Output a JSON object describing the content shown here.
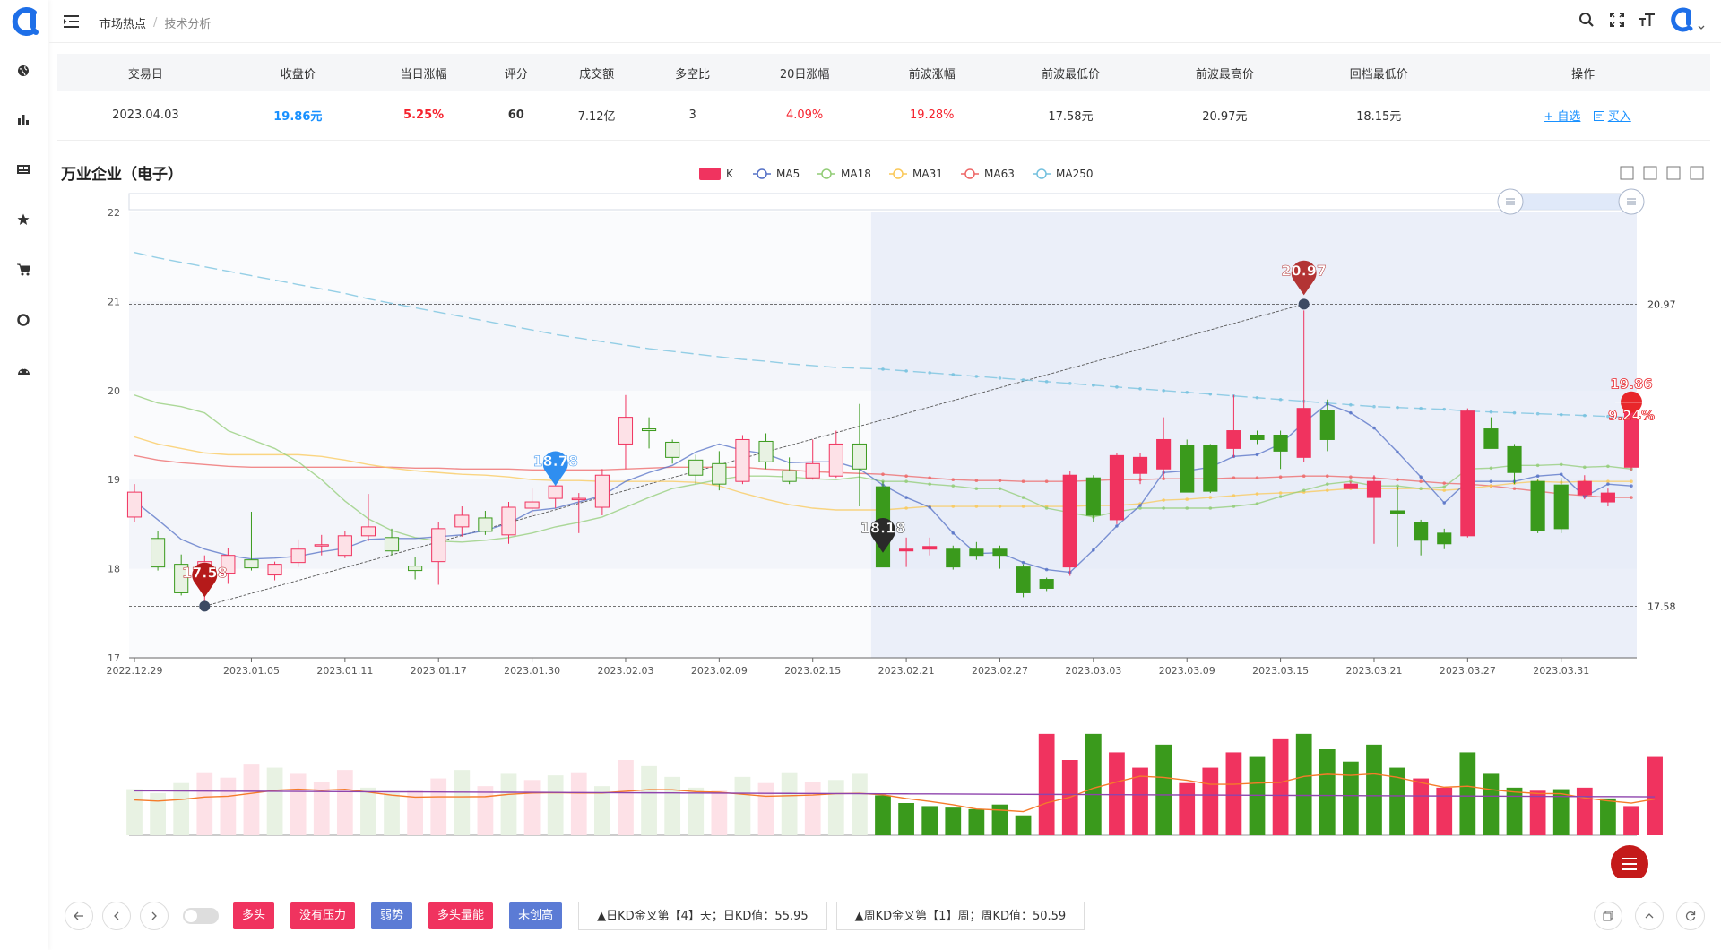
{
  "breadcrumb": {
    "first": "市场热点",
    "sep": "/",
    "second": "技术分析"
  },
  "sidebar_icons": [
    "globe-icon",
    "bar-chart-icon",
    "news-icon",
    "star-icon",
    "cart-icon",
    "life-ring-icon",
    "dashboard-icon"
  ],
  "table": {
    "headers": [
      "交易日",
      "收盘价",
      "当日涨幅",
      "评分",
      "成交额",
      "多空比",
      "20日涨幅",
      "前波涨幅",
      "前波最低价",
      "前波最高价",
      "回档最低价",
      "操作"
    ],
    "row": [
      "2023.04.03",
      "19.86元",
      "5.25%",
      "60",
      "7.12亿",
      "3",
      "4.09%",
      "19.28%",
      "17.58元",
      "20.97元",
      "18.15元"
    ],
    "op_add": "+ 自选",
    "op_buy": "买入"
  },
  "chart": {
    "title": "万业企业（电子）"
  },
  "chart_data": {
    "type": "candlestick",
    "legend": [
      "K",
      "MA5",
      "MA18",
      "MA31",
      "MA63",
      "MA250"
    ],
    "legend_colors": [
      "#f0335f",
      "#5470c6",
      "#91cc75",
      "#fac858",
      "#ee6666",
      "#73c0de"
    ],
    "ylim": [
      17,
      22
    ],
    "yticks": [
      "17",
      "18",
      "19",
      "20",
      "21",
      "22"
    ],
    "xticks": [
      "2022.12.29",
      "2023.01.05",
      "2023.01.11",
      "2023.01.17",
      "2023.01.30",
      "2023.02.03",
      "2023.02.09",
      "2023.02.15",
      "2023.02.21",
      "2023.02.27",
      "2023.03.03",
      "2023.03.09",
      "2023.03.15",
      "2023.03.21",
      "2023.03.27",
      "2023.03.31"
    ],
    "candles": [
      [
        18.58,
        18.86,
        18.95,
        18.52
      ],
      [
        18.34,
        18.02,
        18.42,
        17.98
      ],
      [
        18.05,
        17.73,
        18.16,
        17.7
      ],
      [
        17.9,
        18.08,
        18.15,
        17.58
      ],
      [
        17.95,
        18.15,
        18.23,
        17.83
      ],
      [
        18.1,
        18.01,
        18.64,
        17.98
      ],
      [
        17.93,
        18.05,
        18.08,
        17.87
      ],
      [
        18.07,
        18.22,
        18.33,
        18.02
      ],
      [
        18.27,
        18.27,
        18.38,
        18.15
      ],
      [
        18.15,
        18.37,
        18.42,
        18.12
      ],
      [
        18.37,
        18.47,
        18.84,
        18.31
      ],
      [
        18.35,
        18.2,
        18.45,
        18.15
      ],
      [
        18.03,
        17.98,
        18.13,
        17.88
      ],
      [
        18.08,
        18.45,
        18.52,
        17.82
      ],
      [
        18.47,
        18.6,
        18.7,
        18.36
      ],
      [
        18.57,
        18.42,
        18.65,
        18.38
      ],
      [
        18.38,
        18.69,
        18.75,
        18.28
      ],
      [
        18.68,
        18.75,
        18.9,
        18.59
      ],
      [
        18.79,
        18.93,
        19.15,
        18.68
      ],
      [
        18.79,
        18.79,
        18.85,
        18.4
      ],
      [
        18.69,
        19.05,
        19.12,
        18.6
      ],
      [
        19.4,
        19.7,
        19.95,
        19.12
      ],
      [
        19.57,
        19.55,
        19.7,
        19.35
      ],
      [
        19.42,
        19.25,
        19.45,
        19.18
      ],
      [
        19.22,
        19.05,
        19.28,
        18.95
      ],
      [
        19.18,
        18.95,
        19.32,
        18.88
      ],
      [
        18.98,
        19.45,
        19.5,
        18.95
      ],
      [
        19.43,
        19.2,
        19.52,
        19.12
      ],
      [
        19.1,
        18.98,
        19.25,
        18.95
      ],
      [
        19.02,
        19.18,
        19.45,
        19.0
      ],
      [
        19.04,
        19.4,
        19.55,
        19.02
      ],
      [
        19.4,
        19.12,
        19.85,
        18.7
      ],
      [
        18.92,
        18.02,
        18.98,
        18.02
      ],
      [
        18.2,
        18.22,
        18.35,
        18.02
      ],
      [
        18.22,
        18.25,
        18.35,
        18.15
      ],
      [
        18.22,
        18.02,
        18.26,
        17.99
      ],
      [
        18.22,
        18.15,
        18.3,
        18.1
      ],
      [
        18.22,
        18.15,
        18.26,
        18.0
      ],
      [
        18.02,
        17.73,
        18.05,
        17.68
      ],
      [
        17.88,
        17.78,
        17.9,
        17.75
      ],
      [
        18.02,
        19.05,
        19.1,
        17.92
      ],
      [
        19.02,
        18.6,
        19.05,
        18.52
      ],
      [
        18.55,
        19.27,
        19.3,
        18.5
      ],
      [
        19.07,
        19.25,
        19.3,
        18.95
      ],
      [
        19.12,
        19.45,
        19.7,
        19.02
      ],
      [
        19.38,
        18.86,
        19.45,
        18.86
      ],
      [
        19.38,
        18.87,
        19.4,
        18.85
      ],
      [
        19.35,
        19.55,
        19.95,
        19.25
      ],
      [
        19.5,
        19.45,
        19.55,
        19.4
      ],
      [
        19.5,
        19.32,
        19.55,
        19.12
      ],
      [
        19.25,
        19.8,
        20.9,
        19.2
      ],
      [
        19.78,
        19.45,
        19.9,
        19.32
      ],
      [
        18.9,
        18.95,
        18.98,
        18.9
      ],
      [
        18.8,
        18.98,
        19.05,
        18.28
      ],
      [
        18.65,
        18.62,
        18.92,
        18.25
      ],
      [
        18.52,
        18.32,
        18.55,
        18.15
      ],
      [
        18.4,
        18.28,
        18.45,
        18.22
      ],
      [
        18.37,
        19.77,
        19.8,
        18.35
      ],
      [
        19.57,
        19.35,
        19.7,
        19.35
      ],
      [
        19.37,
        19.08,
        19.4,
        18.95
      ],
      [
        18.98,
        18.43,
        19.0,
        18.4
      ],
      [
        18.94,
        18.45,
        19.02,
        18.4
      ],
      [
        18.83,
        18.98,
        19.05,
        18.78
      ],
      [
        18.75,
        18.85,
        18.9,
        18.7
      ],
      [
        19.14,
        19.86,
        19.95,
        19.1
      ]
    ],
    "ma5": [
      18.76,
      18.55,
      18.33,
      18.22,
      18.15,
      18.11,
      18.12,
      18.14,
      18.19,
      18.23,
      18.33,
      18.34,
      18.34,
      18.36,
      18.38,
      18.43,
      18.51,
      18.65,
      18.68,
      18.75,
      18.82,
      18.98,
      19.08,
      19.16,
      19.31,
      19.4,
      19.33,
      19.29,
      19.19,
      19.2,
      19.2,
      19.12,
      18.94,
      18.8,
      18.69,
      18.4,
      18.17,
      18.18,
      18.07,
      17.99,
      17.96,
      18.21,
      18.48,
      18.71,
      19.08,
      19.1,
      19.14,
      19.26,
      19.28,
      19.4,
      19.64,
      19.85,
      19.75,
      19.58,
      19.31,
      19.03,
      18.74,
      18.98,
      18.98,
      18.98,
      19.04,
      19.06,
      18.81,
      18.95,
      18.93
    ],
    "ma18": [
      19.95,
      19.86,
      19.82,
      19.75,
      19.55,
      19.45,
      19.35,
      19.2,
      19.0,
      18.76,
      18.56,
      18.43,
      18.35,
      18.31,
      18.3,
      18.32,
      18.35,
      18.4,
      18.47,
      18.52,
      18.58,
      18.69,
      18.8,
      18.9,
      18.95,
      19.0,
      19.04,
      19.04,
      19.03,
      19.01,
      19.0,
      19.03,
      18.98,
      18.98,
      18.95,
      18.93,
      18.9,
      18.9,
      18.8,
      18.68,
      18.63,
      18.58,
      18.64,
      18.68,
      18.68,
      18.68,
      18.68,
      18.7,
      18.73,
      18.81,
      18.88,
      18.95,
      18.98,
      18.93,
      18.93,
      18.9,
      18.92,
      19.12,
      19.13,
      19.16,
      19.16,
      19.17,
      19.14,
      19.15,
      19.12
    ],
    "ma31": [
      19.48,
      19.4,
      19.35,
      19.3,
      19.28,
      19.28,
      19.28,
      19.28,
      19.26,
      19.22,
      19.17,
      19.13,
      19.1,
      19.08,
      19.06,
      19.05,
      19.03,
      19.0,
      18.99,
      18.99,
      18.98,
      18.98,
      18.98,
      18.98,
      18.97,
      18.93,
      18.85,
      18.78,
      18.72,
      18.68,
      18.66,
      18.66,
      18.66,
      18.68,
      18.7,
      18.7,
      18.7,
      18.7,
      18.7,
      18.7,
      18.7,
      18.71,
      18.71,
      18.73,
      18.77,
      18.78,
      18.8,
      18.82,
      18.84,
      18.85,
      18.86,
      18.88,
      18.9,
      18.9,
      18.9,
      18.9,
      18.88,
      18.9,
      18.93,
      18.96,
      18.98,
      18.97,
      18.98,
      18.98,
      18.98
    ],
    "ma63": [
      19.27,
      19.22,
      19.19,
      19.17,
      19.15,
      19.14,
      19.14,
      19.14,
      19.14,
      19.14,
      19.14,
      19.14,
      19.13,
      19.13,
      19.12,
      19.12,
      19.12,
      19.11,
      19.11,
      19.11,
      19.11,
      19.12,
      19.13,
      19.14,
      19.14,
      19.14,
      19.14,
      19.12,
      19.11,
      19.09,
      19.08,
      19.07,
      19.06,
      19.04,
      19.02,
      19.0,
      18.99,
      18.99,
      18.98,
      18.98,
      18.98,
      18.99,
      19.0,
      19.0,
      19.01,
      19.01,
      19.01,
      19.02,
      19.02,
      19.03,
      19.04,
      19.04,
      19.03,
      19.02,
      19.0,
      18.98,
      18.96,
      18.95,
      18.93,
      18.9,
      18.87,
      18.84,
      18.82,
      18.8,
      18.8
    ],
    "ma250": [
      21.55,
      21.49,
      21.44,
      21.39,
      21.34,
      21.29,
      21.24,
      21.19,
      21.14,
      21.09,
      21.03,
      20.98,
      20.93,
      20.88,
      20.83,
      20.78,
      20.73,
      20.68,
      20.63,
      20.59,
      20.55,
      20.51,
      20.47,
      20.44,
      20.41,
      20.38,
      20.35,
      20.33,
      20.3,
      20.28,
      20.26,
      20.25,
      20.24,
      20.22,
      20.2,
      20.18,
      20.16,
      20.14,
      20.12,
      20.1,
      20.08,
      20.06,
      20.04,
      20.02,
      20.0,
      19.98,
      19.96,
      19.94,
      19.92,
      19.9,
      19.88,
      19.86,
      19.84,
      19.82,
      19.81,
      19.8,
      19.79,
      19.77,
      19.76,
      19.75,
      19.74,
      19.73,
      19.72,
      19.71,
      19.7
    ],
    "volume": [
      60,
      55,
      68,
      82,
      75,
      92,
      88,
      80,
      70,
      85,
      62,
      55,
      58,
      74,
      85,
      64,
      80,
      72,
      78,
      82,
      64,
      98,
      90,
      76,
      62,
      58,
      76,
      68,
      82,
      70,
      72,
      80,
      52,
      42,
      38,
      36,
      34,
      40,
      26,
      132,
      98,
      132,
      108,
      88,
      118,
      68,
      88,
      108,
      102,
      125,
      132,
      112,
      96,
      118,
      88,
      74,
      62,
      108,
      80,
      62,
      58,
      60,
      62,
      48,
      38,
      102
    ],
    "volume_up": [
      false,
      false,
      false,
      true,
      true,
      true,
      false,
      true,
      true,
      true,
      false,
      false,
      true,
      true,
      false,
      true,
      false,
      true,
      false,
      true,
      false,
      true,
      false,
      false,
      false,
      true,
      false,
      true,
      false,
      true,
      false,
      false,
      false,
      false,
      false,
      false,
      false,
      false,
      false,
      true,
      true,
      false,
      true,
      true,
      false,
      true,
      true,
      true,
      false,
      true,
      false,
      false,
      false,
      false,
      false,
      true,
      true,
      false,
      false,
      false,
      true,
      false,
      true,
      false,
      true,
      true
    ],
    "annotations": [
      {
        "label": "17.58",
        "index": 3,
        "value": 17.58
      },
      {
        "label": "18.78",
        "index": 18,
        "value": 18.93
      },
      {
        "label": "18.18",
        "index": 32,
        "value": 18.18
      },
      {
        "label": "20.97",
        "index": 50,
        "value": 20.97
      },
      {
        "label": "19.86",
        "index": 64,
        "value": 19.86
      },
      {
        "label": "9.24%",
        "index": 64,
        "value": 19.86
      }
    ],
    "hlines": [
      {
        "label": "20.97",
        "value": 20.97
      },
      {
        "label": "17.58",
        "value": 17.58
      }
    ]
  },
  "footer": {
    "tags": [
      {
        "label": "多头",
        "color": "#f0335f"
      },
      {
        "label": "没有压力",
        "color": "#f0335f"
      },
      {
        "label": "弱势",
        "color": "#5b7bd5"
      },
      {
        "label": "多头量能",
        "color": "#f0335f"
      },
      {
        "label": "未创高",
        "color": "#5b7bd5"
      }
    ],
    "kd_daily": "▲日KD金叉第【4】天；日KD值：55.95",
    "kd_weekly": "▲周KD金叉第【1】周；周KD值：50.59"
  }
}
